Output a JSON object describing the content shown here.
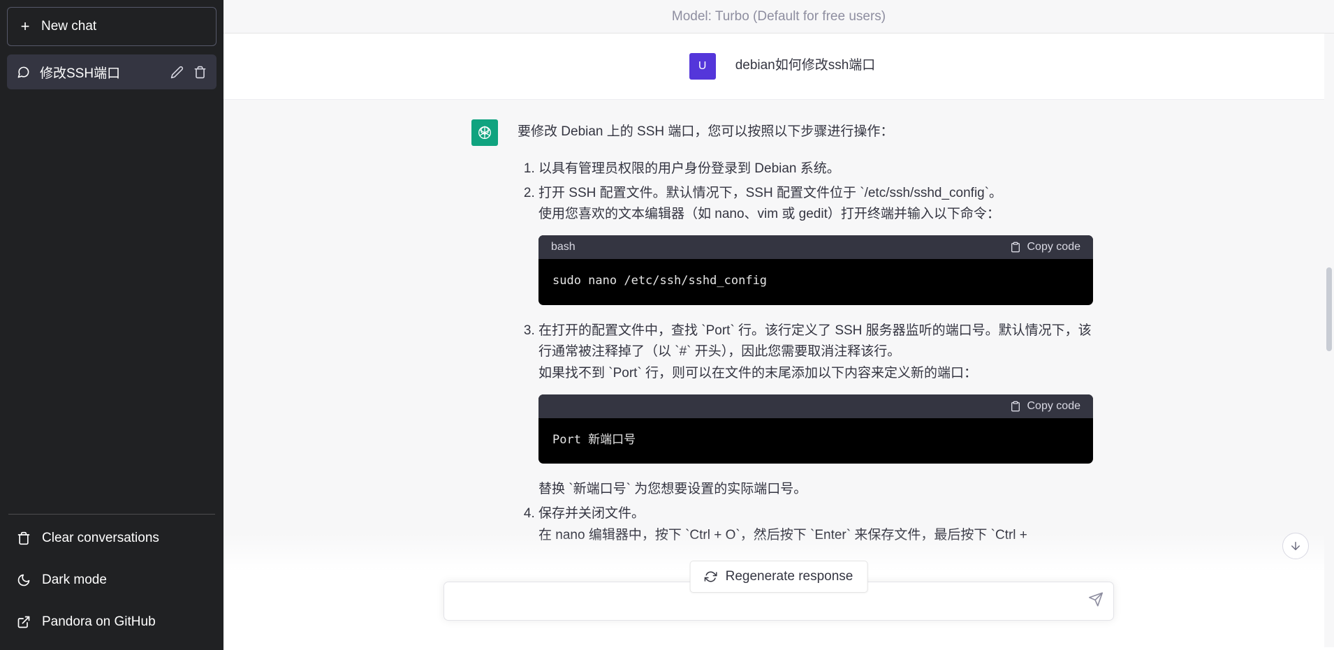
{
  "sidebar": {
    "new_chat_label": "New chat",
    "conversations": [
      {
        "title": "修改SSH端口",
        "edit_title": "Edit",
        "delete_title": "Delete"
      }
    ],
    "footer_items": [
      {
        "label": "Clear conversations",
        "icon": "trash-icon"
      },
      {
        "label": "Dark mode",
        "icon": "moon-icon"
      },
      {
        "label": "Pandora on GitHub",
        "icon": "external-link-icon"
      }
    ]
  },
  "header": {
    "model_label": "Model: Turbo (Default for free users)"
  },
  "messages": {
    "user": {
      "avatar_letter": "U",
      "text": "debian如何修改ssh端口"
    },
    "assistant": {
      "intro": "要修改 Debian 上的 SSH 端口，您可以按照以下步骤进行操作：",
      "step1": "以具有管理员权限的用户身份登录到 Debian 系统。",
      "step2_line1": "打开 SSH 配置文件。默认情况下，SSH 配置文件位于 `/etc/ssh/sshd_config`。",
      "step2_line2": "使用您喜欢的文本编辑器（如 nano、vim 或 gedit）打开终端并输入以下命令：",
      "step3_line1": "在打开的配置文件中，查找 `Port` 行。该行定义了 SSH 服务器监听的端口号。默认情况下，该行通常被注释掉了（以 `#` 开头），因此您需要取消注释该行。",
      "step3_line2": "如果找不到 `Port` 行，则可以在文件的末尾添加以下内容来定义新的端口：",
      "after_code2": "替换 `新端口号` 为您想要设置的实际端口号。",
      "step4_line1": "保存并关闭文件。",
      "step4_line2": "在 nano 编辑器中，按下 `Ctrl + O`，然后按下 `Enter` 来保存文件，最后按下 `Ctrl +"
    }
  },
  "code_blocks": [
    {
      "language": "bash",
      "copy_label": "Copy code",
      "code": "sudo nano /etc/ssh/sshd_config"
    },
    {
      "language": "",
      "copy_label": "Copy code",
      "code": "Port 新端口号"
    }
  ],
  "actions": {
    "regenerate_label": "Regenerate response"
  },
  "composer": {
    "value": "",
    "placeholder": ""
  },
  "colors": {
    "sidebar_bg": "#202123",
    "sidebar_active": "#343541",
    "assistant_accent": "#10a37f",
    "user_accent": "#5436da",
    "code_bg": "#000000",
    "code_head_bg": "#343541",
    "assistant_msg_bg": "#f7f7f8"
  }
}
